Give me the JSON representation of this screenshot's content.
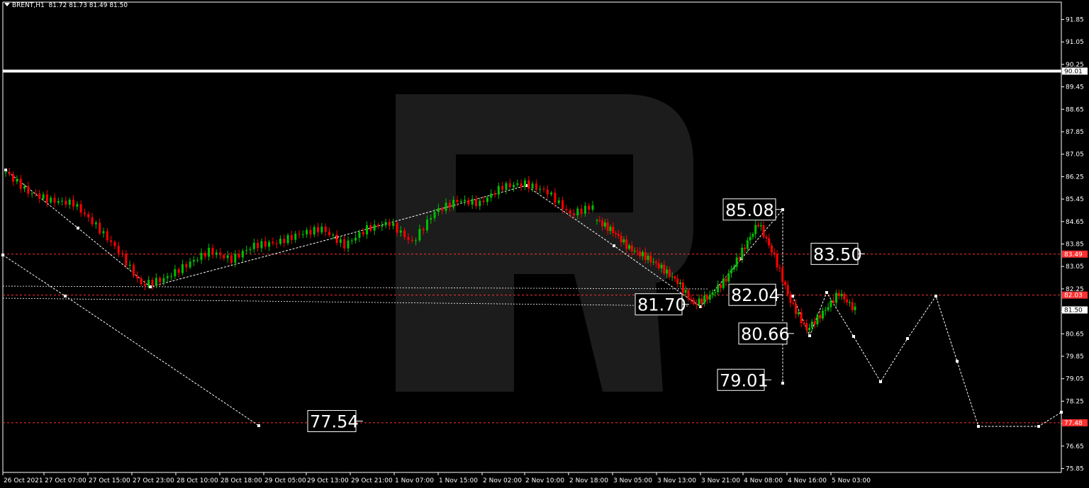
{
  "header": {
    "symbol_timeframe": "BRENT,H1",
    "ohlc": "81.72 81.73 81.49 81.50"
  },
  "colors": {
    "background": "#000000",
    "bull_candle": "#00c000",
    "bear_candle": "#ff0000",
    "level_line": "#ff3030",
    "projection": "#ffffff",
    "watermark": "#1c1c1c"
  },
  "watermark_icon": "roboforex-r-logo",
  "chart_data": {
    "type": "line",
    "title": "BRENT,H1",
    "ylim": [
      75.85,
      92.25
    ],
    "y_ticks": [
      "91.85",
      "91.05",
      "90.25",
      "89.45",
      "88.65",
      "87.85",
      "87.05",
      "86.25",
      "85.45",
      "84.65",
      "83.85",
      "83.05",
      "82.25",
      "81.50",
      "80.65",
      "79.85",
      "79.05",
      "78.25",
      "77.45",
      "76.65",
      "75.85"
    ],
    "x_ticks": [
      "26 Oct 2021",
      "27 Oct 07:00",
      "27 Oct 15:00",
      "27 Oct 23:00",
      "28 Oct 10:00",
      "28 Oct 18:00",
      "29 Oct 05:00",
      "29 Oct 13:00",
      "29 Oct 21:00",
      "1 Nov 07:00",
      "1 Nov 15:00",
      "2 Nov 02:00",
      "2 Nov 10:00",
      "2 Nov 18:00",
      "3 Nov 05:00",
      "3 Nov 13:00",
      "3 Nov 21:00",
      "4 Nov 08:00",
      "4 Nov 16:00",
      "5 Nov 03:00"
    ],
    "grid": false,
    "horizontal_levels": [
      {
        "value": 90.01,
        "label": "90.01",
        "style": "solid-white"
      },
      {
        "value": 83.49,
        "label": "83.49",
        "style": "dashed-red"
      },
      {
        "value": 82.03,
        "label": "82.03",
        "style": "dashed-red"
      },
      {
        "value": 77.48,
        "label": "77.48",
        "style": "dashed-red"
      }
    ],
    "current_price": {
      "value": 81.5,
      "label": "81.50"
    },
    "annotations": [
      {
        "text": "85.08",
        "value": 85.08
      },
      {
        "text": "83.50",
        "value": 83.5
      },
      {
        "text": "82.04",
        "value": 82.04
      },
      {
        "text": "81.70",
        "value": 81.7
      },
      {
        "text": "80.66",
        "value": 80.66
      },
      {
        "text": "79.01",
        "value": 79.01
      },
      {
        "text": "77.54",
        "value": 77.54
      }
    ],
    "series": [
      {
        "values": [
          86.4,
          85.7,
          85.4,
          85.3,
          84.5,
          83.6,
          82.4,
          82.6,
          83.1,
          83.6,
          83.3,
          83.8,
          83.9,
          84.2,
          84.4,
          83.8,
          84.4,
          84.6,
          83.9,
          85.0,
          85.4,
          85.3,
          85.9,
          86.0,
          85.7,
          84.9,
          85.2
        ]
      },
      {
        "values": [
          84.7,
          84.3,
          83.7,
          83.4,
          83.0,
          82.5,
          81.7,
          82.0,
          82.6,
          83.6,
          84.6,
          83.4,
          81.8,
          80.8,
          81.4,
          82.1,
          81.5
        ]
      }
    ]
  }
}
